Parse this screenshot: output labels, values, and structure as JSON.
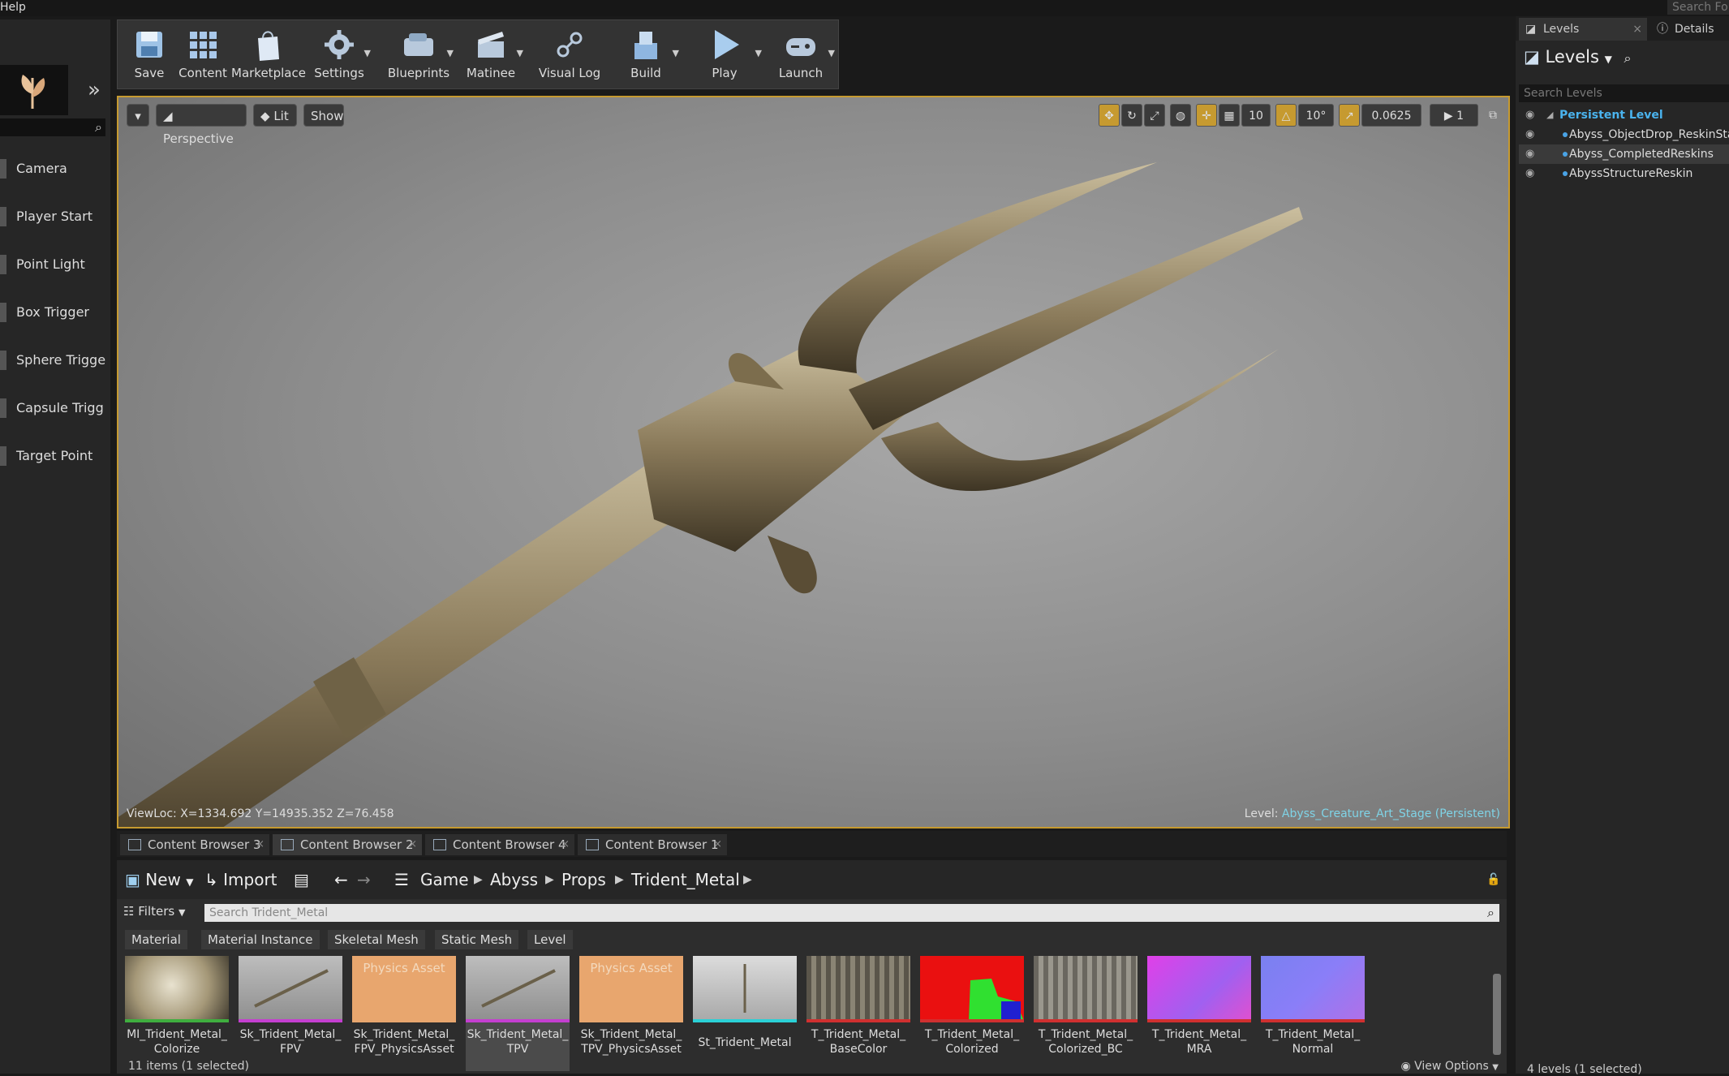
{
  "menubar": {
    "help": "Help",
    "search_placeholder": "Search Fo"
  },
  "modes": {
    "items": [
      {
        "label": "Camera"
      },
      {
        "label": "Player Start"
      },
      {
        "label": "Point Light"
      },
      {
        "label": "Box Trigger"
      },
      {
        "label": "Sphere Trigge"
      },
      {
        "label": "Capsule Trigg"
      },
      {
        "label": "Target Point"
      }
    ]
  },
  "toolbar": {
    "save": "Save",
    "content": "Content",
    "marketplace": "Marketplace",
    "settings": "Settings",
    "blueprints": "Blueprints",
    "matinee": "Matinee",
    "visual_log": "Visual Log",
    "build": "Build",
    "play": "Play",
    "launch": "Launch"
  },
  "viewport": {
    "perspective": "Perspective",
    "lit": "Lit",
    "show": "Show",
    "grid_snap": "10",
    "rot_snap": "10°",
    "scale_snap": "0.0625",
    "camera_speed": "1",
    "viewloc": "ViewLoc: X=1334.692 Y=14935.352 Z=76.458",
    "level_label": "Level:",
    "level_name": "Abyss_Creature_Art_Stage (Persistent)"
  },
  "content_browser": {
    "tabs": [
      "Content Browser 3",
      "Content Browser 2",
      "Content Browser 4",
      "Content Browser 1"
    ],
    "new": "New",
    "import": "Import",
    "path": [
      "Game",
      "Abyss",
      "Props",
      "Trident_Metal"
    ],
    "filters": "Filters",
    "search_placeholder": "Search Trident_Metal",
    "filter_chips": [
      "Material",
      "Material Instance",
      "Skeletal Mesh",
      "Static Mesh",
      "Level"
    ],
    "assets": [
      {
        "line1": "MI_Trident_Metal_",
        "line2": "Colorize"
      },
      {
        "line1": "Sk_Trident_Metal_",
        "line2": "FPV"
      },
      {
        "line1": "Sk_Trident_Metal_",
        "line2": "FPV_PhysicsAsset",
        "overlay": "Physics Asset"
      },
      {
        "line1": "Sk_Trident_Metal_",
        "line2": "TPV"
      },
      {
        "line1": "Sk_Trident_Metal_",
        "line2": "TPV_PhysicsAsset",
        "overlay": "Physics Asset"
      },
      {
        "line1": "St_Trident_Metal",
        "line2": ""
      },
      {
        "line1": "T_Trident_Metal_",
        "line2": "BaseColor"
      },
      {
        "line1": "T_Trident_Metal_",
        "line2": "Colorized"
      },
      {
        "line1": "T_Trident_Metal_",
        "line2": "Colorized_BC"
      },
      {
        "line1": "T_Trident_Metal_",
        "line2": "MRA"
      },
      {
        "line1": "T_Trident_Metal_",
        "line2": "Normal"
      }
    ],
    "status": "11 items (1 selected)",
    "view_options": "View Options"
  },
  "levels_panel": {
    "tab_levels": "Levels",
    "tab_details": "Details",
    "header": "Levels",
    "search_placeholder": "Search Levels",
    "items": [
      {
        "label": "Persistent Level"
      },
      {
        "label": "Abyss_ObjectDrop_ReskinSta"
      },
      {
        "label": "Abyss_CompletedReskins"
      },
      {
        "label": "AbyssStructureReskin"
      }
    ],
    "status": "4 levels (1 selected)"
  }
}
